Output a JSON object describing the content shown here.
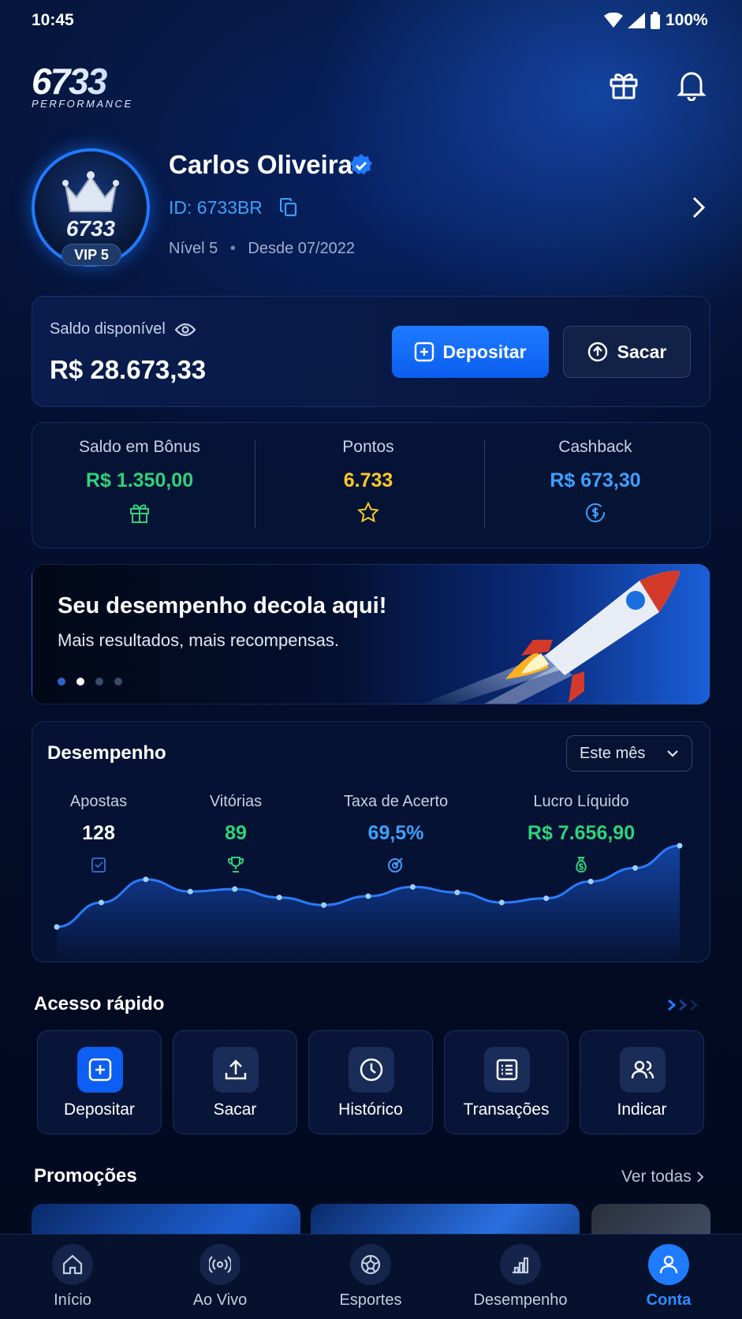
{
  "status": {
    "time": "10:45",
    "battery": "100%"
  },
  "brand": {
    "logo_number": "6733",
    "logo_sub": "PERFORMANCE"
  },
  "profile": {
    "name": "Carlos Oliveira",
    "id": "ID: 6733BR",
    "level": "Nível 5",
    "since": "Desde 07/2022",
    "avatar_text": "6733",
    "vip": "VIP 5"
  },
  "balance": {
    "label": "Saldo disponível",
    "value": "R$ 28.673,33",
    "deposit": "Depositar",
    "withdraw": "Sacar"
  },
  "stats": [
    {
      "label": "Saldo em Bônus",
      "value": "R$ 1.350,00",
      "color": "#2fd27a",
      "icon": "gift-icon"
    },
    {
      "label": "Pontos",
      "value": "6.733",
      "color": "#ffc928",
      "icon": "star-icon"
    },
    {
      "label": "Cashback",
      "value": "R$ 673,30",
      "color": "#3ea0ff",
      "icon": "coin-icon"
    }
  ],
  "banner": {
    "title": "Seu desempenho decola aqui!",
    "subtitle": "Mais resultados, mais recompensas.",
    "slides": 4,
    "active_slide": 1
  },
  "performance": {
    "title": "Desempenho",
    "period": "Este mês",
    "metrics": [
      {
        "label": "Apostas",
        "value": "128",
        "color": "#ffffff"
      },
      {
        "label": "Vitórias",
        "value": "89",
        "color": "#2fd27a"
      },
      {
        "label": "Taxa de Acerto",
        "value": "69,5%",
        "color": "#3ea0ff"
      },
      {
        "label": "Lucro Líquido",
        "value": "R$ 7.656,90",
        "color": "#2fd27a"
      }
    ]
  },
  "chart_data": {
    "type": "area",
    "values": [
      0,
      0.58,
      1.13,
      0.84,
      0.9,
      0.7,
      0.52,
      0.73,
      0.95,
      0.82,
      0.58,
      0.68,
      1.08,
      1.4,
      1.93
    ]
  },
  "quick": {
    "title": "Acesso rápido",
    "items": [
      {
        "label": "Depositar",
        "icon": "deposit-icon",
        "active": true
      },
      {
        "label": "Sacar",
        "icon": "upload-icon",
        "active": false
      },
      {
        "label": "Histórico",
        "icon": "clock-icon",
        "active": false
      },
      {
        "label": "Transações",
        "icon": "list-icon",
        "active": false
      },
      {
        "label": "Indicar",
        "icon": "users-icon",
        "active": false
      }
    ]
  },
  "promos": {
    "title": "Promoções",
    "see_all": "Ver todas"
  },
  "nav": [
    {
      "label": "Início",
      "icon": "home-icon",
      "active": false
    },
    {
      "label": "Ao Vivo",
      "icon": "live-icon",
      "active": false
    },
    {
      "label": "Esportes",
      "icon": "ball-icon",
      "active": false
    },
    {
      "label": "Desempenho",
      "icon": "chart-icon",
      "active": false
    },
    {
      "label": "Conta",
      "icon": "user-icon",
      "active": true
    }
  ],
  "colors": {
    "accent": "#1f7bff",
    "green": "#2fd27a",
    "gold": "#ffc928",
    "blue": "#3ea0ff"
  }
}
